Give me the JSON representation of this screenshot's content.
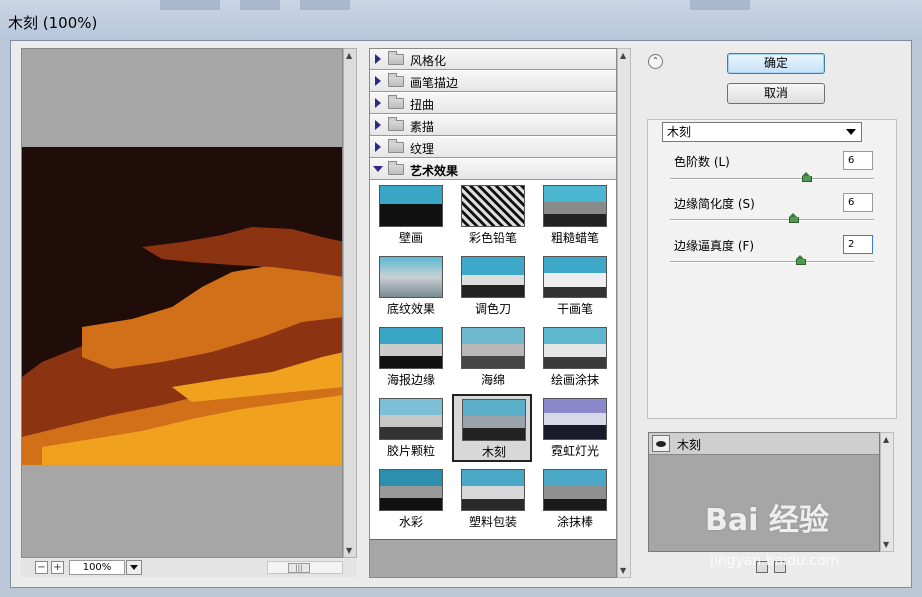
{
  "window": {
    "title": "木刻 (100%)"
  },
  "preview": {
    "zoom": "100%",
    "zoom_out": "−",
    "zoom_in": "+"
  },
  "categories": [
    {
      "label": "风格化",
      "open": false
    },
    {
      "label": "画笔描边",
      "open": false
    },
    {
      "label": "扭曲",
      "open": false
    },
    {
      "label": "素描",
      "open": false
    },
    {
      "label": "纹理",
      "open": false
    },
    {
      "label": "艺术效果",
      "open": true
    }
  ],
  "filters": [
    {
      "label": "壁画"
    },
    {
      "label": "彩色铅笔"
    },
    {
      "label": "粗糙蜡笔"
    },
    {
      "label": "底纹效果"
    },
    {
      "label": "调色刀"
    },
    {
      "label": "干画笔"
    },
    {
      "label": "海报边缘"
    },
    {
      "label": "海绵"
    },
    {
      "label": "绘画涂抹"
    },
    {
      "label": "胶片颗粒"
    },
    {
      "label": "木刻",
      "selected": true
    },
    {
      "label": "霓虹灯光"
    },
    {
      "label": "水彩"
    },
    {
      "label": "塑料包装"
    },
    {
      "label": "涂抹棒"
    }
  ],
  "buttons": {
    "ok": "确定",
    "cancel": "取消"
  },
  "settings": {
    "filter_select": "木刻",
    "params": [
      {
        "label": "色阶数 (L)",
        "value": "6",
        "level": 0.67
      },
      {
        "label": "边缘简化度 (S)",
        "value": "6",
        "level": 0.6
      },
      {
        "label": "边缘逼真度 (F)",
        "value": "2",
        "level": 0.64
      }
    ]
  },
  "layers": {
    "items": [
      {
        "label": "木刻"
      }
    ]
  },
  "watermark": {
    "brand": "Bai  经验",
    "url": "jingyan.baidu.com"
  },
  "colors": {
    "preview_dark": "#200c08",
    "preview_brown": "#8c3312",
    "preview_orange": "#d2701a",
    "preview_gold": "#f0a21e",
    "accent_button": "#3c7fb1"
  }
}
